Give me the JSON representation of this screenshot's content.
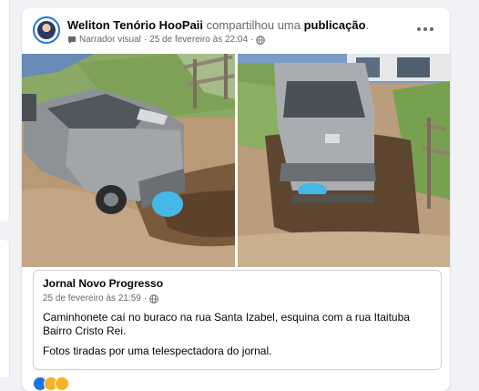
{
  "post": {
    "author": "Weliton Tenório HooPaii",
    "action": "compartilhou uma",
    "target": "publicação",
    "target_suffix": ".",
    "narrator_label": "Narrador visual",
    "separator": "·",
    "timestamp": "25 de fevereiro às 22:04",
    "privacy_icon": "globe-icon",
    "more_icon": "more-options-icon"
  },
  "photos": [
    {
      "description_icon": "photo-truck-in-hole-left"
    },
    {
      "description_icon": "photo-truck-in-hole-right"
    }
  ],
  "shared_post": {
    "page_name": "Jornal Novo Progresso",
    "timestamp": "25 de fevereiro às 21:59",
    "separator": "·",
    "text_line1": "Caminhonete caí no buraco na rua Santa Izabel, esquina com a rua Itaituba Bairro Cristo Rei.",
    "text_line2": "Fotos tiradas por uma telespectadora do jornal."
  },
  "colors": {
    "accent": "#1b74e4",
    "meta_text": "#65676b",
    "page_bg": "#f0f2f5",
    "card_bg": "#ffffff",
    "blur_patch": "#46b8e8"
  }
}
